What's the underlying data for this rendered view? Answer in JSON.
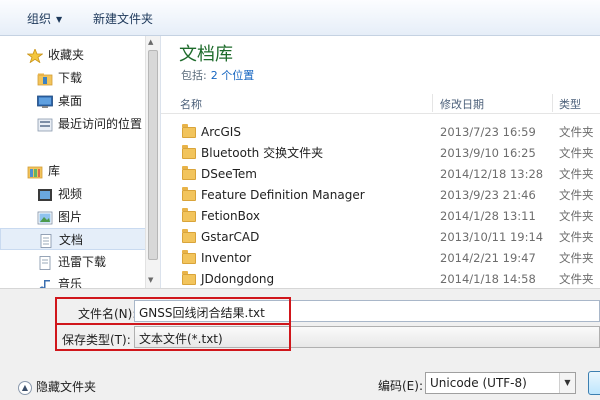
{
  "toolbar": {
    "organize": "组织",
    "new_folder": "新建文件夹"
  },
  "nav": {
    "items": [
      {
        "label": "收藏夹",
        "icon": "star-icon"
      },
      {
        "label": "下载",
        "icon": "folder-icon"
      },
      {
        "label": "桌面",
        "icon": "desktop-icon"
      },
      {
        "label": "最近访问的位置",
        "icon": "recent-places-icon"
      },
      {
        "label": "库",
        "icon": "library-icon"
      },
      {
        "label": "视频",
        "icon": "video-library-icon"
      },
      {
        "label": "图片",
        "icon": "picture-library-icon"
      },
      {
        "label": "文档",
        "icon": "document-library-icon"
      },
      {
        "label": "迅雷下载",
        "icon": "document-icon"
      },
      {
        "label": "音乐",
        "icon": "music-library-icon"
      }
    ]
  },
  "main": {
    "title": "文档库",
    "includes_label": "包括:",
    "includes_link": "2 个位置",
    "columns": {
      "name": "名称",
      "modified": "修改日期",
      "type": "类型"
    },
    "rows": [
      {
        "name": "ArcGIS",
        "date": "2013/7/23 16:59",
        "type": "文件夹"
      },
      {
        "name": "Bluetooth 交换文件夹",
        "date": "2013/9/10 16:25",
        "type": "文件夹"
      },
      {
        "name": "DSeeTem",
        "date": "2014/12/18 13:28",
        "type": "文件夹"
      },
      {
        "name": "Feature Definition Manager",
        "date": "2013/9/23 21:46",
        "type": "文件夹"
      },
      {
        "name": "FetionBox",
        "date": "2014/1/28 13:11",
        "type": "文件夹"
      },
      {
        "name": "GstarCAD",
        "date": "2013/10/11 19:14",
        "type": "文件夹"
      },
      {
        "name": "Inventor",
        "date": "2014/2/21 19:47",
        "type": "文件夹"
      },
      {
        "name": "JDdongdong",
        "date": "2014/1/18 14:58",
        "type": "文件夹"
      }
    ]
  },
  "form": {
    "filename_label": "文件名(N):",
    "filename_value": "GNSS回线闭合结果.txt",
    "filetype_label": "保存类型(T):",
    "filetype_value": "文本文件(*.txt)",
    "hide_folders": "隐藏文件夹",
    "encoding_label": "编码(E):",
    "encoding_value": "Unicode (UTF-8)"
  },
  "colors": {
    "title_green": "#1e6b2b",
    "link_blue": "#1565c0",
    "highlight_red": "#d0161b",
    "folder_yellow": "#f2c45c"
  }
}
